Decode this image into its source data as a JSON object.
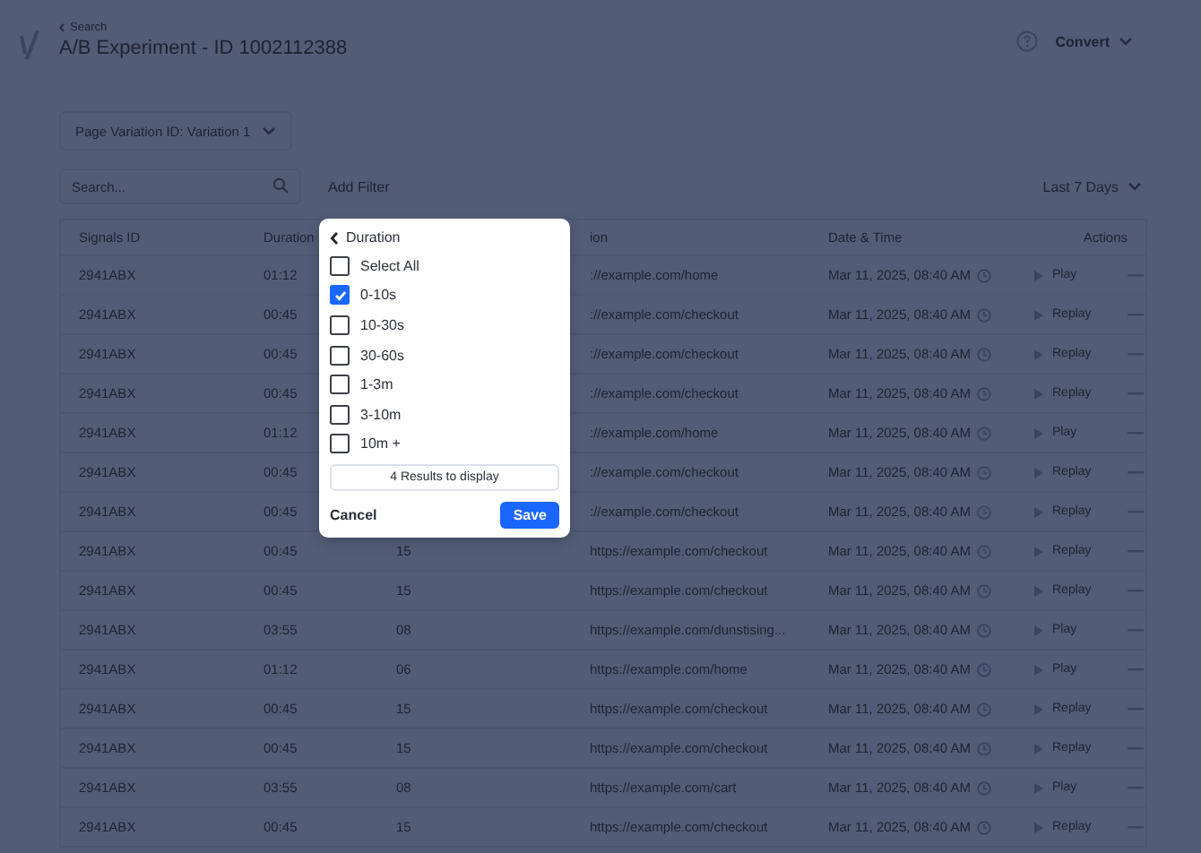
{
  "header": {
    "back_link": "Search",
    "title": "A/B Experiment - ID 1002112388",
    "convert_menu": "Convert"
  },
  "filters": {
    "variation_dropdown": "Page Variation ID: Variation 1",
    "search": {
      "placeholder": "Search..."
    },
    "add_filter": "Add Filter",
    "date_range": "Last 7 Days"
  },
  "table": {
    "columns": [
      "Signals ID",
      "Duration",
      "ion",
      "Date & Time",
      "Actions"
    ],
    "rows": [
      {
        "signals_id": "2941ABX",
        "duration": "01:12",
        "url": "://example.com/home",
        "date": "Mar 11, 2025, 08:40 AM",
        "action": "Play"
      },
      {
        "signals_id": "2941ABX",
        "duration": "00:45",
        "url": "://example.com/checkout",
        "date": "Mar 11, 2025, 08:40 AM",
        "action": "Replay"
      },
      {
        "signals_id": "2941ABX",
        "duration": "00:45",
        "url": "://example.com/checkout",
        "date": "Mar 11, 2025, 08:40 AM",
        "action": "Replay"
      },
      {
        "signals_id": "2941ABX",
        "duration": "00:45",
        "url": "://example.com/checkout",
        "date": "Mar 11, 2025, 08:40 AM",
        "action": "Replay"
      },
      {
        "signals_id": "2941ABX",
        "duration": "01:12",
        "url": "://example.com/home",
        "date": "Mar 11, 2025, 08:40 AM",
        "action": "Play"
      },
      {
        "signals_id": "2941ABX",
        "duration": "00:45",
        "url": "://example.com/checkout",
        "date": "Mar 11, 2025, 08:40 AM",
        "action": "Replay"
      },
      {
        "signals_id": "2941ABX",
        "duration": "00:45",
        "url": "://example.com/checkout",
        "date": "Mar 11, 2025, 08:40 AM",
        "action": "Replay"
      },
      {
        "signals_id": "2941ABX",
        "duration": "00:45",
        "column_3": "15",
        "url": "https://example.com/checkout",
        "date": "Mar 11, 2025, 08:40 AM",
        "action": "Replay"
      },
      {
        "signals_id": "2941ABX",
        "duration": "00:45",
        "column_3": "15",
        "url": "https://example.com/checkout",
        "date": "Mar 11, 2025, 08:40 AM",
        "action": "Replay"
      },
      {
        "signals_id": "2941ABX",
        "duration": "03:55",
        "column_3": "08",
        "url": "https://example.com/dunstising...",
        "date": "Mar 11, 2025, 08:40 AM",
        "action": "Play"
      },
      {
        "signals_id": "2941ABX",
        "duration": "01:12",
        "column_3": "06",
        "url": "https://example.com/home",
        "date": "Mar 11, 2025, 08:40 AM",
        "action": "Play"
      },
      {
        "signals_id": "2941ABX",
        "duration": "00:45",
        "column_3": "15",
        "url": "https://example.com/checkout",
        "date": "Mar 11, 2025, 08:40 AM",
        "action": "Replay"
      },
      {
        "signals_id": "2941ABX",
        "duration": "00:45",
        "column_3": "15",
        "url": "https://example.com/checkout",
        "date": "Mar 11, 2025, 08:40 AM",
        "action": "Replay"
      },
      {
        "signals_id": "2941ABX",
        "duration": "03:55",
        "column_3": "08",
        "url": "https://example.com/cart",
        "date": "Mar 11, 2025, 08:40 AM",
        "action": "Play"
      },
      {
        "signals_id": "2941ABX",
        "duration": "00:45",
        "column_3": "15",
        "url": "https://example.com/checkout",
        "date": "Mar 11, 2025, 08:40 AM",
        "action": "Replay"
      }
    ]
  },
  "dialog": {
    "title": "Duration",
    "options": [
      {
        "label": "Select All",
        "checked": false
      },
      {
        "label": "0-10s",
        "checked": true
      },
      {
        "label": "10-30s",
        "checked": false
      },
      {
        "label": "30-60s",
        "checked": false
      },
      {
        "label": "1-3m",
        "checked": false
      },
      {
        "label": "3-10m",
        "checked": false
      },
      {
        "label": "10m +",
        "checked": false
      }
    ],
    "results_button": "4 Results to display",
    "cancel": "Cancel",
    "save": "Save"
  }
}
